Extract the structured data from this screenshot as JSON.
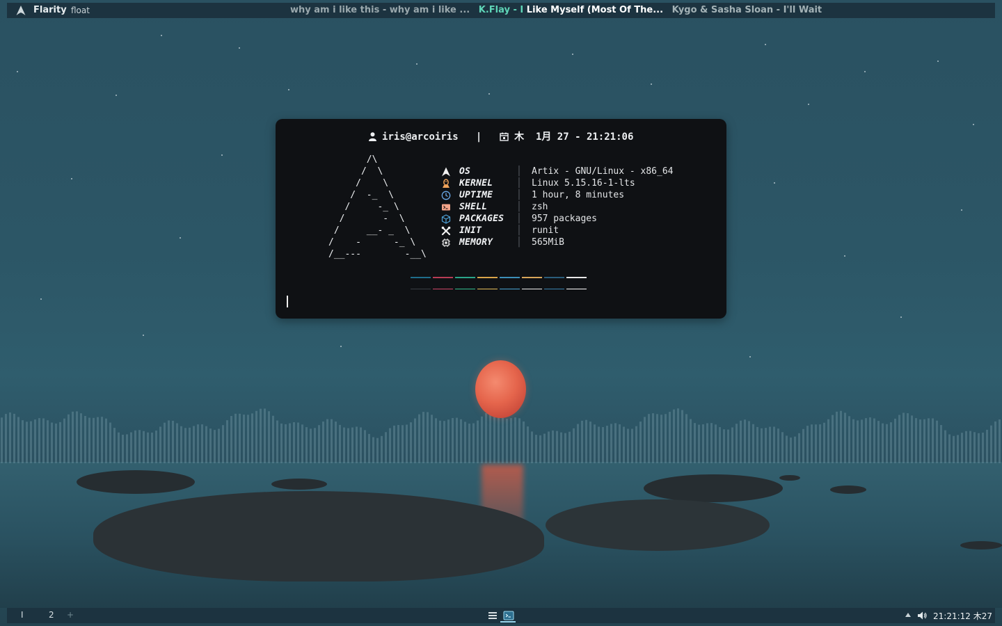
{
  "topbar": {
    "wm_name": "Flarity",
    "layout": "float",
    "tasks": {
      "first": "why am i like this - why am i like ...",
      "active_artist": "K.Flay",
      "active_separator": "- I",
      "active_song": "Like Myself (Most Of The...",
      "third": "Kygo & Sasha Sloan - I'll Wait"
    }
  },
  "terminal": {
    "user": "iris@arcoiris",
    "separator": "|",
    "date": "木  1月 27 - 21:21:06",
    "ascii_art": "       /\\\n      /  \\\n     /    \\\n    /  -_  \\\n   /     -_ \\\n  /       -  \\\n /     __- _  \\\n/    -      -_ \\\n/__---        -__\\",
    "info": [
      {
        "key": "OS",
        "icon": "arch-icon",
        "value": "Artix - GNU/Linux - x86_64",
        "color": "#f0f0f0"
      },
      {
        "key": "KERNEL",
        "icon": "tux-icon",
        "value": "Linux 5.15.16-1-lts",
        "color": "#f0a35a"
      },
      {
        "key": "UPTIME",
        "icon": "clock-icon",
        "value": "1 hour, 8 minutes",
        "color": "#6aa9e8"
      },
      {
        "key": "SHELL",
        "icon": "terminal-icon",
        "value": "zsh",
        "color": "#f4a58a"
      },
      {
        "key": "PACKAGES",
        "icon": "box-icon",
        "value": "957 packages",
        "color": "#4fa3d9"
      },
      {
        "key": "INIT",
        "icon": "tools-icon",
        "value": "runit",
        "color": "#f0f0f0"
      },
      {
        "key": "MEMORY",
        "icon": "chip-icon",
        "value": "565MiB",
        "color": "#e8e8e8"
      }
    ],
    "palette_top": [
      "#1f6d8c",
      "#b83c55",
      "#2aa58a",
      "#d9a44a",
      "#3c8fb8",
      "#d8a65a",
      "#2a5d7c",
      "#e8e8e8"
    ],
    "palette_bottom": [
      "#3a3f45",
      "#d0486a",
      "#34c090",
      "#e6c05c",
      "#4aa6d6",
      "#f0f0f0",
      "#3a84b0",
      "#ffffff"
    ]
  },
  "bottombar": {
    "workspaces": [
      "I",
      "2"
    ],
    "add": "+",
    "clock": "21:21:12 木27"
  }
}
